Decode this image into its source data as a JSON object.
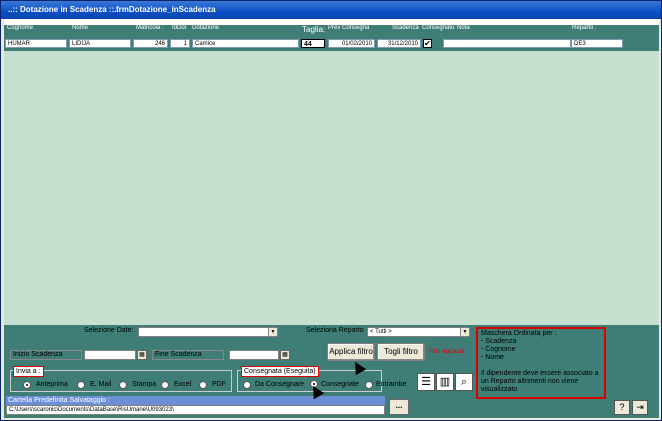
{
  "window": {
    "title": "..:: Dotazione in Scadenza ::..",
    "subtitle": "frmDotazione_inScadenza"
  },
  "columns": {
    "cognome": "Cognome",
    "nome": "Nome",
    "matricola": "Matricola :",
    "iddot": "IdDot",
    "dotazione": "Dotazione",
    "taglia": "Taglia:",
    "prevconsegna": "Prev Consegna",
    "scadenza": "Scadenza",
    "consegnato": "Consegnato",
    "nota": "Nota",
    "reparto": "Reparto :"
  },
  "rows": [
    {
      "cognome": "HUMAR",
      "nome": "LIDIJA",
      "matricola": "246",
      "iddot": "1",
      "dotazione": "Camice",
      "taglia": "44",
      "prevconsegna": "01/02/2010",
      "scadenza": "31/12/2010",
      "consegnato": "✔",
      "nota": "",
      "reparto": "DE3"
    }
  ],
  "filters": {
    "selezione_date_label": "Selezione Date:",
    "seleziona_reparto_label": "Seleziona Reparto",
    "reparto_value": "<  Tutti  >",
    "inizio_label": "Inizio Scadenza",
    "fine_label": "Fine Scadenza",
    "applica_label": "Applica filtro",
    "togli_label": "Togli filtro",
    "filtri_applicati": "Filtri Applicati"
  },
  "invia": {
    "title": "Invia a :",
    "options": [
      "Anteprima",
      "E. Mail",
      "Stampa",
      "Excel",
      "PDF"
    ]
  },
  "consegnata": {
    "title": "Consegnata (Eseguita)",
    "options": [
      "Da Consegnare",
      "Consegnate",
      "Entrambe"
    ]
  },
  "cartella": {
    "label": "Cartella Predefinita Salvataggio :",
    "path": "C:\\Users\\scaronic\\Documents\\DataBase\\RisUmane\\U093023\\",
    "browse_label": "..."
  },
  "note": "Maschera Ordinata per :\n- Scadenza\n- Cognome\n- Nome\n\nIl dipendente deve essere associato a un Reparto altrimenti non viene visualizzato",
  "colors": {
    "teal": "#3e7e76",
    "detail": "#c6e0cf",
    "title": "#0a4fc4",
    "alert": "#dd0000"
  }
}
